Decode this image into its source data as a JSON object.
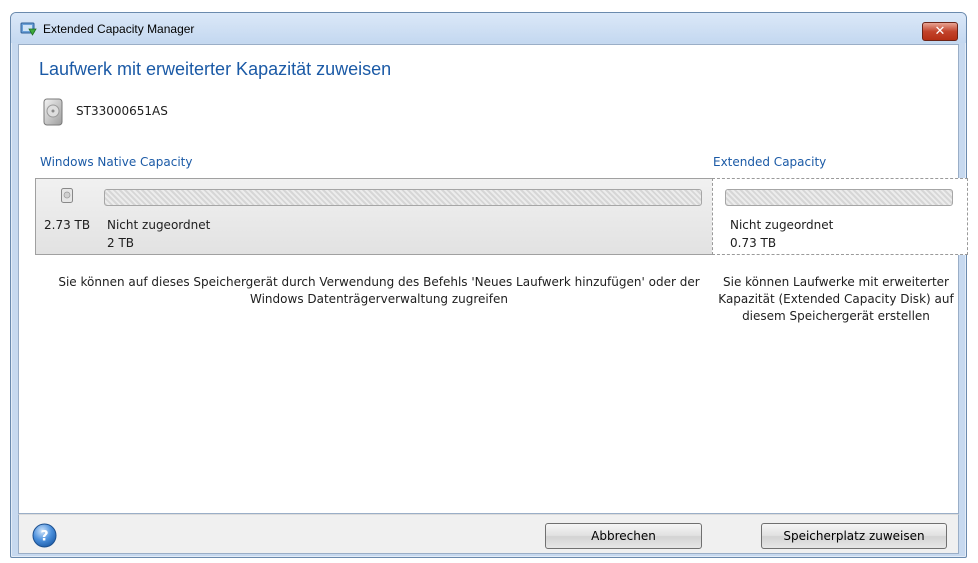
{
  "window": {
    "title": "Extended Capacity Manager",
    "close_glyph": "✕"
  },
  "page": {
    "title": "Laufwerk mit erweiterter Kapazität zuweisen"
  },
  "disk": {
    "name": "ST33000651AS",
    "icon": "hard-disk-icon"
  },
  "native": {
    "heading": "Windows Native Capacity",
    "total_size": "2.73 TB",
    "partition_label": "Nicht zugeordnet",
    "partition_size": "2 TB",
    "description": "Sie können auf dieses Speichergerät durch Verwendung des Befehls 'Neues Laufwerk hinzufügen' oder der Windows Datenträgerverwaltung zugreifen"
  },
  "extended": {
    "heading": "Extended Capacity",
    "partition_label": "Nicht zugeordnet",
    "partition_size": "0.73 TB",
    "description": "Sie können Laufwerke mit erweiterter Kapazität (Extended Capacity Disk) auf diesem Speichergerät erstellen"
  },
  "footer": {
    "help_icon": "help-icon",
    "cancel_label": "Abbrechen",
    "assign_label": "Speicherplatz zuweisen"
  },
  "colors": {
    "accent": "#1b5aa6",
    "close": "#c2432b",
    "frame": "#c7d9ef"
  }
}
